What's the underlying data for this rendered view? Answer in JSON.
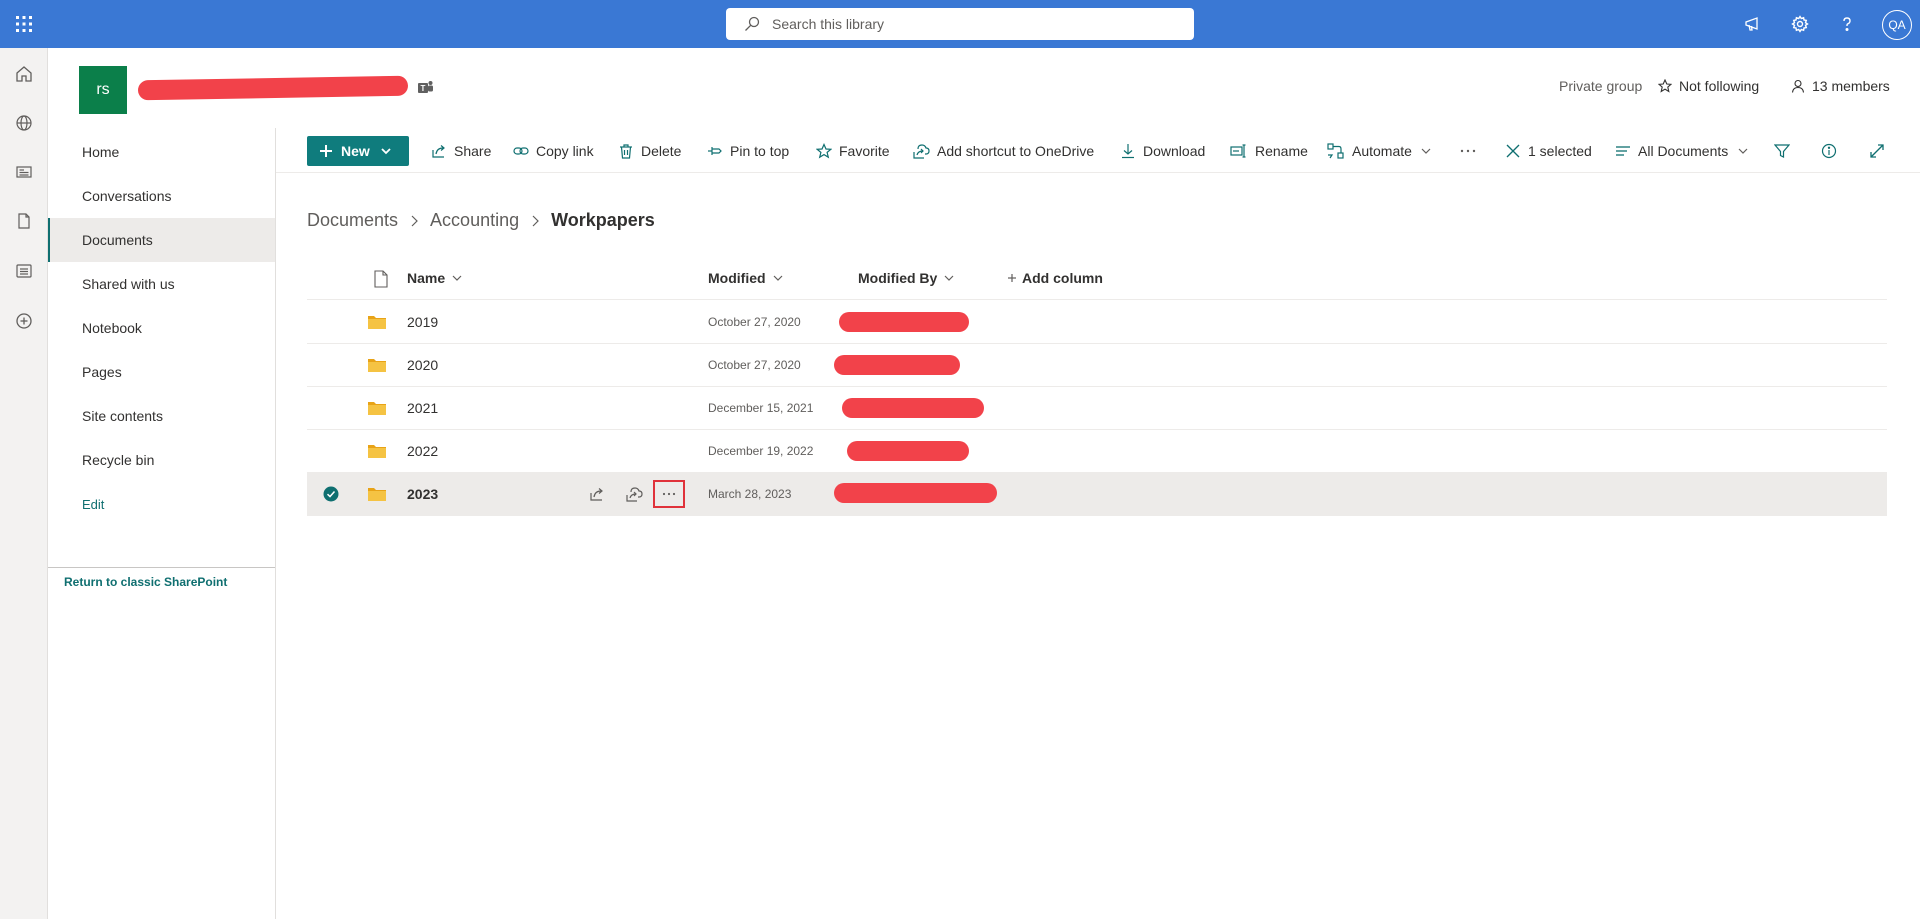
{
  "suitebar": {
    "search_placeholder": "Search this library",
    "avatar_initials": "QA"
  },
  "site": {
    "logo_initials": "rs",
    "privacy": "Private group",
    "follow_label": "Not following",
    "members_label": "13 members"
  },
  "nav": {
    "items": [
      "Home",
      "Conversations",
      "Documents",
      "Shared with us",
      "Notebook",
      "Pages",
      "Site contents",
      "Recycle bin"
    ],
    "edit_label": "Edit",
    "classic_link": "Return to classic SharePoint"
  },
  "commands": {
    "new_label": "New",
    "share": "Share",
    "copy_link": "Copy link",
    "delete": "Delete",
    "pin_to_top": "Pin to top",
    "favorite": "Favorite",
    "add_shortcut": "Add shortcut to OneDrive",
    "download": "Download",
    "rename": "Rename",
    "automate": "Automate",
    "selected": "1 selected",
    "view": "All Documents"
  },
  "breadcrumb": [
    "Documents",
    "Accounting",
    "Workpapers"
  ],
  "list": {
    "columns": {
      "name": "Name",
      "modified": "Modified",
      "modified_by": "Modified By",
      "add_column": "Add column"
    },
    "rows": [
      {
        "name": "2019",
        "modified": "October 27, 2020",
        "selected": false
      },
      {
        "name": "2020",
        "modified": "October 27, 2020",
        "selected": false
      },
      {
        "name": "2021",
        "modified": "December 15, 2021",
        "selected": false
      },
      {
        "name": "2022",
        "modified": "December 19, 2022",
        "selected": false
      },
      {
        "name": "2023",
        "modified": "March 28, 2023",
        "selected": true
      }
    ]
  },
  "colors": {
    "suitebar": "#3a78d4",
    "accent": "#0f7c7d",
    "site_logo": "#0b7f4a",
    "folder": "#f5c343",
    "redaction": "#f2424a"
  }
}
